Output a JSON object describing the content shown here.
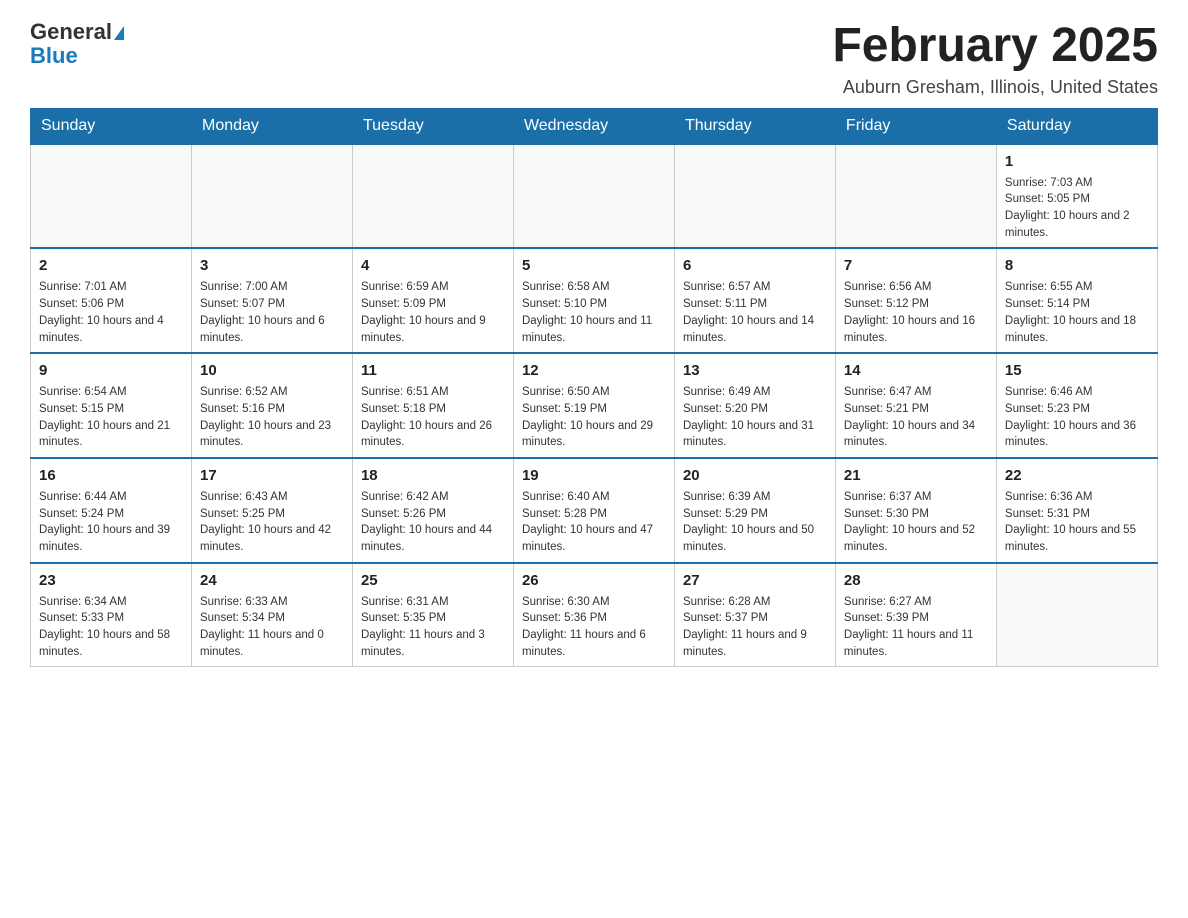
{
  "logo": {
    "general": "General",
    "blue": "Blue"
  },
  "header": {
    "title": "February 2025",
    "subtitle": "Auburn Gresham, Illinois, United States"
  },
  "weekdays": [
    "Sunday",
    "Monday",
    "Tuesday",
    "Wednesday",
    "Thursday",
    "Friday",
    "Saturday"
  ],
  "weeks": [
    [
      {
        "day": "",
        "info": ""
      },
      {
        "day": "",
        "info": ""
      },
      {
        "day": "",
        "info": ""
      },
      {
        "day": "",
        "info": ""
      },
      {
        "day": "",
        "info": ""
      },
      {
        "day": "",
        "info": ""
      },
      {
        "day": "1",
        "info": "Sunrise: 7:03 AM\nSunset: 5:05 PM\nDaylight: 10 hours and 2 minutes."
      }
    ],
    [
      {
        "day": "2",
        "info": "Sunrise: 7:01 AM\nSunset: 5:06 PM\nDaylight: 10 hours and 4 minutes."
      },
      {
        "day": "3",
        "info": "Sunrise: 7:00 AM\nSunset: 5:07 PM\nDaylight: 10 hours and 6 minutes."
      },
      {
        "day": "4",
        "info": "Sunrise: 6:59 AM\nSunset: 5:09 PM\nDaylight: 10 hours and 9 minutes."
      },
      {
        "day": "5",
        "info": "Sunrise: 6:58 AM\nSunset: 5:10 PM\nDaylight: 10 hours and 11 minutes."
      },
      {
        "day": "6",
        "info": "Sunrise: 6:57 AM\nSunset: 5:11 PM\nDaylight: 10 hours and 14 minutes."
      },
      {
        "day": "7",
        "info": "Sunrise: 6:56 AM\nSunset: 5:12 PM\nDaylight: 10 hours and 16 minutes."
      },
      {
        "day": "8",
        "info": "Sunrise: 6:55 AM\nSunset: 5:14 PM\nDaylight: 10 hours and 18 minutes."
      }
    ],
    [
      {
        "day": "9",
        "info": "Sunrise: 6:54 AM\nSunset: 5:15 PM\nDaylight: 10 hours and 21 minutes."
      },
      {
        "day": "10",
        "info": "Sunrise: 6:52 AM\nSunset: 5:16 PM\nDaylight: 10 hours and 23 minutes."
      },
      {
        "day": "11",
        "info": "Sunrise: 6:51 AM\nSunset: 5:18 PM\nDaylight: 10 hours and 26 minutes."
      },
      {
        "day": "12",
        "info": "Sunrise: 6:50 AM\nSunset: 5:19 PM\nDaylight: 10 hours and 29 minutes."
      },
      {
        "day": "13",
        "info": "Sunrise: 6:49 AM\nSunset: 5:20 PM\nDaylight: 10 hours and 31 minutes."
      },
      {
        "day": "14",
        "info": "Sunrise: 6:47 AM\nSunset: 5:21 PM\nDaylight: 10 hours and 34 minutes."
      },
      {
        "day": "15",
        "info": "Sunrise: 6:46 AM\nSunset: 5:23 PM\nDaylight: 10 hours and 36 minutes."
      }
    ],
    [
      {
        "day": "16",
        "info": "Sunrise: 6:44 AM\nSunset: 5:24 PM\nDaylight: 10 hours and 39 minutes."
      },
      {
        "day": "17",
        "info": "Sunrise: 6:43 AM\nSunset: 5:25 PM\nDaylight: 10 hours and 42 minutes."
      },
      {
        "day": "18",
        "info": "Sunrise: 6:42 AM\nSunset: 5:26 PM\nDaylight: 10 hours and 44 minutes."
      },
      {
        "day": "19",
        "info": "Sunrise: 6:40 AM\nSunset: 5:28 PM\nDaylight: 10 hours and 47 minutes."
      },
      {
        "day": "20",
        "info": "Sunrise: 6:39 AM\nSunset: 5:29 PM\nDaylight: 10 hours and 50 minutes."
      },
      {
        "day": "21",
        "info": "Sunrise: 6:37 AM\nSunset: 5:30 PM\nDaylight: 10 hours and 52 minutes."
      },
      {
        "day": "22",
        "info": "Sunrise: 6:36 AM\nSunset: 5:31 PM\nDaylight: 10 hours and 55 minutes."
      }
    ],
    [
      {
        "day": "23",
        "info": "Sunrise: 6:34 AM\nSunset: 5:33 PM\nDaylight: 10 hours and 58 minutes."
      },
      {
        "day": "24",
        "info": "Sunrise: 6:33 AM\nSunset: 5:34 PM\nDaylight: 11 hours and 0 minutes."
      },
      {
        "day": "25",
        "info": "Sunrise: 6:31 AM\nSunset: 5:35 PM\nDaylight: 11 hours and 3 minutes."
      },
      {
        "day": "26",
        "info": "Sunrise: 6:30 AM\nSunset: 5:36 PM\nDaylight: 11 hours and 6 minutes."
      },
      {
        "day": "27",
        "info": "Sunrise: 6:28 AM\nSunset: 5:37 PM\nDaylight: 11 hours and 9 minutes."
      },
      {
        "day": "28",
        "info": "Sunrise: 6:27 AM\nSunset: 5:39 PM\nDaylight: 11 hours and 11 minutes."
      },
      {
        "day": "",
        "info": ""
      }
    ]
  ]
}
